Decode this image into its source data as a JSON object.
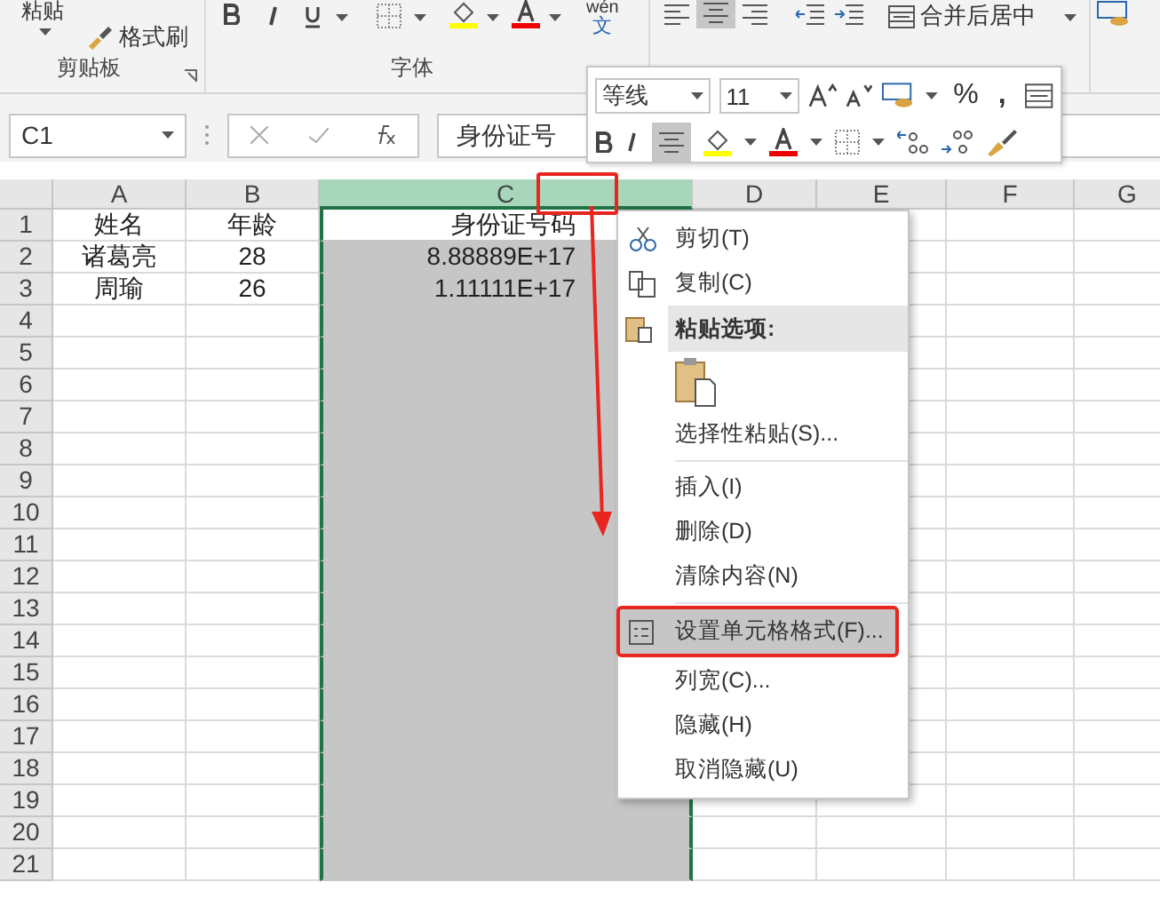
{
  "ribbon": {
    "paste_label": "粘贴",
    "format_painter": "格式刷",
    "clipboard_group": "剪贴板",
    "font_group": "字体",
    "phonetic_top": "wén",
    "phonetic_bottom": "文",
    "merge_center": "合并后居中"
  },
  "formula_bar": {
    "name_box": "C1",
    "formula": "身份证号"
  },
  "mini_toolbar": {
    "font": "等线",
    "size": "11",
    "percent": "%",
    "comma": ","
  },
  "columns": [
    {
      "label": "A",
      "selected": false
    },
    {
      "label": "B",
      "selected": false
    },
    {
      "label": "C",
      "selected": true
    },
    {
      "label": "D",
      "selected": false
    },
    {
      "label": "E",
      "selected": false
    },
    {
      "label": "F",
      "selected": false
    },
    {
      "label": "G",
      "selected": false
    }
  ],
  "rows": [
    {
      "number": "1",
      "cells": [
        "姓名",
        "年龄",
        "身份证号码"
      ]
    },
    {
      "number": "2",
      "cells": [
        "诸葛亮",
        "28",
        "8.88889E+17"
      ]
    },
    {
      "number": "3",
      "cells": [
        "周瑜",
        "26",
        "1.11111E+17"
      ]
    },
    {
      "number": "4"
    },
    {
      "number": "5"
    },
    {
      "number": "6"
    },
    {
      "number": "7"
    },
    {
      "number": "8"
    },
    {
      "number": "9"
    },
    {
      "number": "10"
    },
    {
      "number": "11"
    },
    {
      "number": "12"
    },
    {
      "number": "13"
    },
    {
      "number": "14"
    },
    {
      "number": "15"
    },
    {
      "number": "16"
    },
    {
      "number": "17"
    },
    {
      "number": "18"
    },
    {
      "number": "19"
    },
    {
      "number": "20"
    },
    {
      "number": "21"
    }
  ],
  "context_menu": [
    {
      "kind": "item",
      "label": "剪切(T)",
      "selected": false
    },
    {
      "kind": "item",
      "label": "复制(C)",
      "selected": false
    },
    {
      "kind": "header",
      "label": "粘贴选项:"
    },
    {
      "kind": "paste_icons"
    },
    {
      "kind": "item",
      "label": "选择性粘贴(S)...",
      "selected": false
    },
    {
      "kind": "separator"
    },
    {
      "kind": "item",
      "label": "插入(I)",
      "selected": false
    },
    {
      "kind": "item",
      "label": "删除(D)",
      "selected": false
    },
    {
      "kind": "item",
      "label": "清除内容(N)",
      "selected": false
    },
    {
      "kind": "separator"
    },
    {
      "kind": "item",
      "label": "设置单元格格式(F)...",
      "selected": true
    },
    {
      "kind": "item",
      "label": "列宽(C)...",
      "selected": false
    },
    {
      "kind": "item",
      "label": "隐藏(H)",
      "selected": false
    },
    {
      "kind": "item",
      "label": "取消隐藏(U)",
      "selected": false
    }
  ]
}
